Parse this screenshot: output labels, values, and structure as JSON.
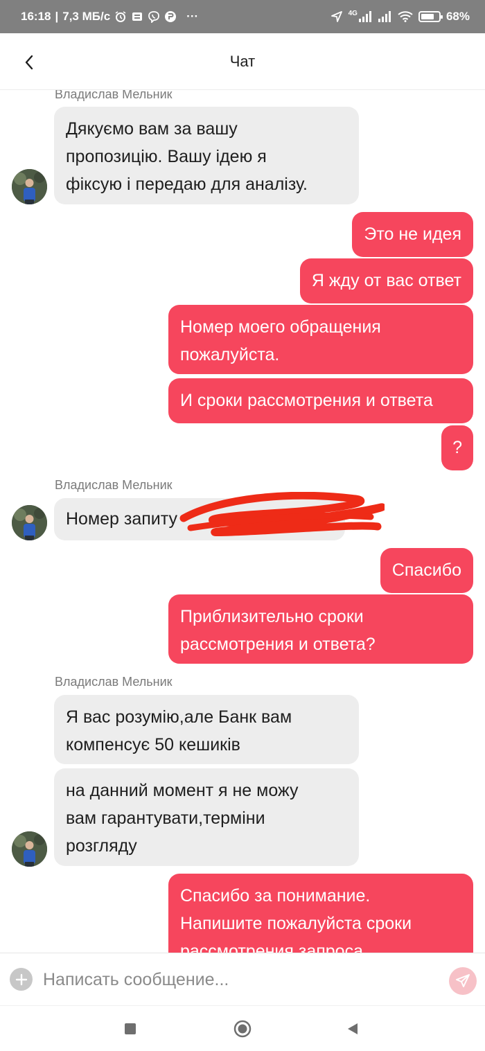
{
  "status_bar": {
    "time": "16:18",
    "net_speed": "7,3 МБ/с",
    "more": "···",
    "network_type": "4G",
    "battery": "68%"
  },
  "header": {
    "title": "Чат"
  },
  "messages": [
    {
      "sender": "Владислав Мельник",
      "text_lines": [
        "Дякуємо вам за вашу",
        "пропозицію. Вашу ідею я",
        "фіксую і передаю для аналізу."
      ]
    },
    {
      "text": "Это не идея"
    },
    {
      "text": "Я жду от вас ответ"
    },
    {
      "text_lines": [
        "Номер моего обращения",
        "пожалуйста."
      ]
    },
    {
      "text": "И сроки рассмотрения и ответа"
    },
    {
      "text": "?"
    },
    {
      "sender": "Владислав Мельник",
      "text": "Номер запиту"
    },
    {
      "text": "Спасибо"
    },
    {
      "text_lines": [
        "Приблизительно сроки",
        "рассмотрения и ответа?"
      ]
    },
    {
      "sender": "Владислав Мельник",
      "text_lines": [
        "Я вас розумію,але Банк вам",
        "компенсує 50 кешиків"
      ]
    },
    {
      "text_lines": [
        "на данний момент я не можу",
        "вам гарантувати,терміни",
        "розгляду"
      ]
    },
    {
      "text_lines": [
        "Спасибо за понимание.",
        "Напишите пожалуйста сроки",
        "рассмотрения запроса"
      ]
    }
  ],
  "composer": {
    "placeholder": "Написать сообщение..."
  },
  "colors": {
    "accent": "#f6465d",
    "incoming_bubble": "#ededed",
    "status_bar": "#808080",
    "scribble": "#ee2b17"
  },
  "icons": {
    "back": "chevron-left-icon",
    "add": "plus-icon",
    "send": "send-icon",
    "nav_recent": "square-icon",
    "nav_home": "circle-icon",
    "nav_back": "triangle-icon"
  }
}
